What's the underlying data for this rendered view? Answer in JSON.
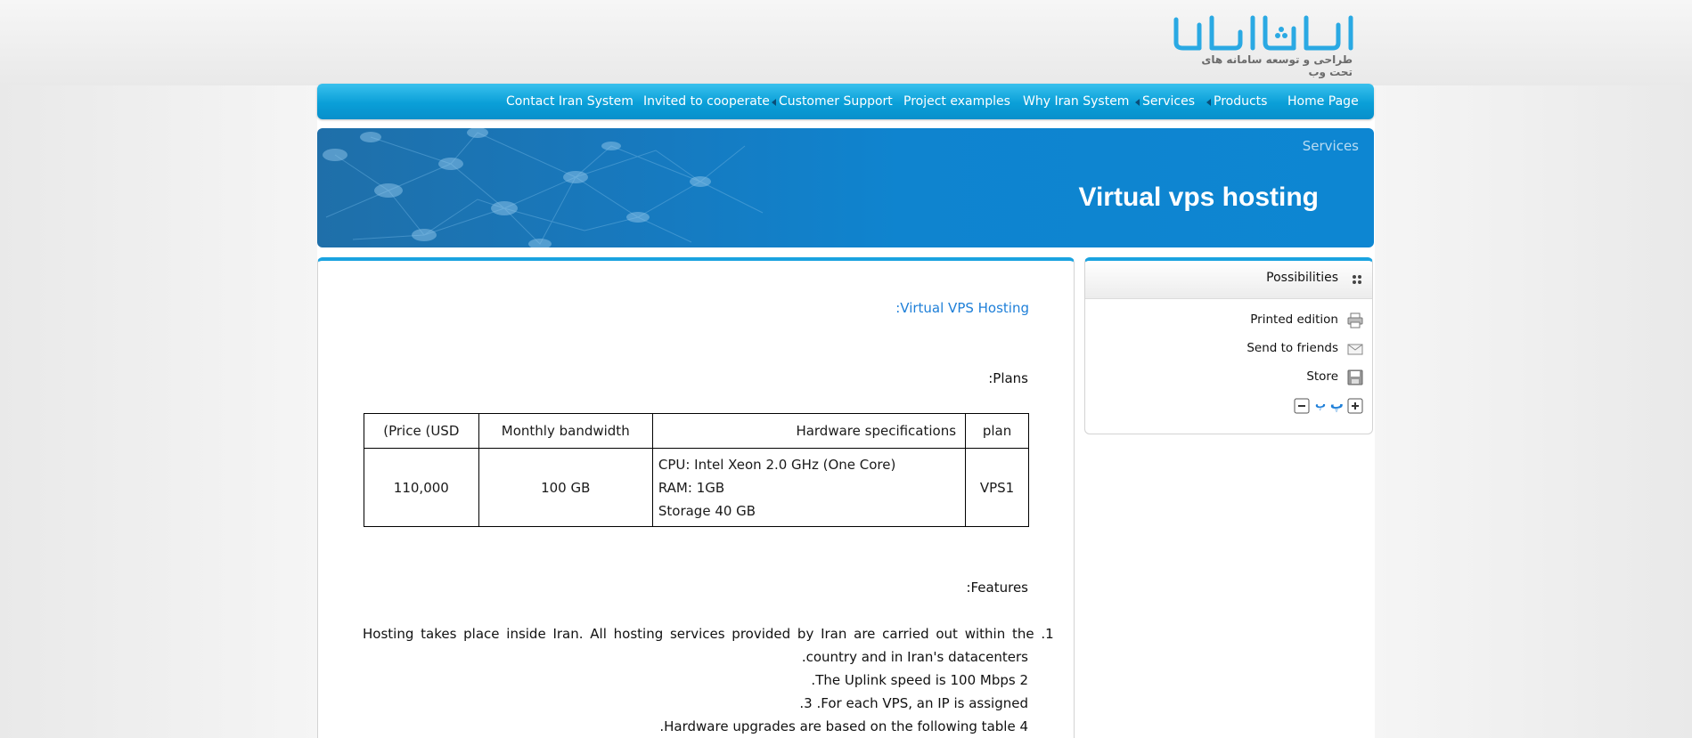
{
  "logo": {
    "text": "ایرانسیستم",
    "tagline": "طراحی و توسعه سامانه های تحت وب"
  },
  "nav": {
    "items": [
      {
        "label": "Home Page",
        "has_submenu": false
      },
      {
        "label": "Products",
        "has_submenu": true
      },
      {
        "label": "Services",
        "has_submenu": true
      },
      {
        "label": "Why Iran System",
        "has_submenu": false
      },
      {
        "label": "Project examples",
        "has_submenu": false
      },
      {
        "label": "Customer Support",
        "has_submenu": true
      },
      {
        "label": "Invited to cooperate",
        "has_submenu": false
      },
      {
        "label": "Contact Iran System",
        "has_submenu": false
      }
    ]
  },
  "banner": {
    "breadcrumb": "Services",
    "title": "Virtual vps hosting"
  },
  "sidebar": {
    "title": "Possibilities",
    "links": [
      {
        "label": "Printed edition",
        "icon": "printer-icon"
      },
      {
        "label": "Send to friends",
        "icon": "envelope-icon"
      },
      {
        "label": "Store",
        "icon": "floppy-disk-icon"
      }
    ],
    "font_controls": {
      "increase": "+",
      "large": "پ",
      "small": "پ",
      "decrease": "−"
    }
  },
  "content": {
    "heading": ":Virtual VPS Hosting",
    "plans_label": ":Plans",
    "table": {
      "headers": {
        "price": "(Price (USD",
        "bandwidth": "Monthly bandwidth",
        "hardware": "Hardware specifications",
        "plan": "plan"
      },
      "rows": [
        {
          "price": "110,000",
          "bandwidth": "100 GB",
          "hardware": [
            "CPU: Intel Xeon 2.0 GHz (One Core)",
            "RAM: 1GB",
            "Storage 40 GB"
          ],
          "plan": "VPS1"
        }
      ]
    },
    "features_label": ":Features",
    "features": [
      "Hosting takes place inside Iran. All hosting services provided by Iran are carried out within the .1",
      ".country and in Iran's datacenters",
      ".The Uplink speed is 100 Mbps 2",
      ".3 .For each VPS, an IP is assigned",
      ".Hardware upgrades are based on the following table 4"
    ]
  },
  "colors": {
    "nav": "#0a9fd8",
    "banner": "#0f84cf",
    "heading": "#1e7fd8",
    "accent_border": "#1aa3e0"
  }
}
